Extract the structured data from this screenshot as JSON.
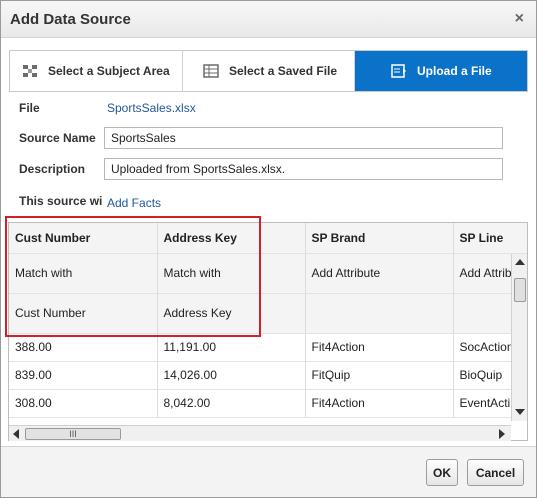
{
  "dialog": {
    "title": "Add Data Source",
    "close_glyph": "×"
  },
  "tabs": [
    {
      "label": "Select a Subject Area",
      "icon": "subject-area-icon"
    },
    {
      "label": "Select a Saved File",
      "icon": "saved-file-icon"
    },
    {
      "label": "Upload a File",
      "icon": "upload-file-icon",
      "selected": true
    }
  ],
  "form": {
    "file_label": "File",
    "file_value": "SportsSales.xlsx",
    "source_name_label": "Source Name",
    "source_name_value": "SportsSales",
    "description_label": "Description",
    "description_value": "Uploaded from SportsSales.xlsx.",
    "source_type_label": "This source wi",
    "source_type_link": "Add Facts"
  },
  "grid": {
    "columns": [
      "Cust Number",
      "Address Key",
      "SP Brand",
      "SP Line"
    ],
    "match_row": [
      "Match with",
      "Match with",
      "Add Attribute",
      "Add Attrib"
    ],
    "link_row": [
      "Cust Number",
      "Address Key",
      "",
      ""
    ],
    "rows": [
      [
        "388.00",
        "11,191.00",
        "Fit4Action",
        "SocAction"
      ],
      [
        "839.00",
        "14,026.00",
        "FitQuip",
        "BioQuip"
      ],
      [
        "308.00",
        "8,042.00",
        "Fit4Action",
        "EventActi"
      ]
    ],
    "hscroll_grip": "III"
  },
  "buttons": {
    "ok": "OK",
    "cancel": "Cancel"
  },
  "colors": {
    "accent": "#0a72c9",
    "highlight": "#d0202a",
    "link": "#21589a"
  }
}
